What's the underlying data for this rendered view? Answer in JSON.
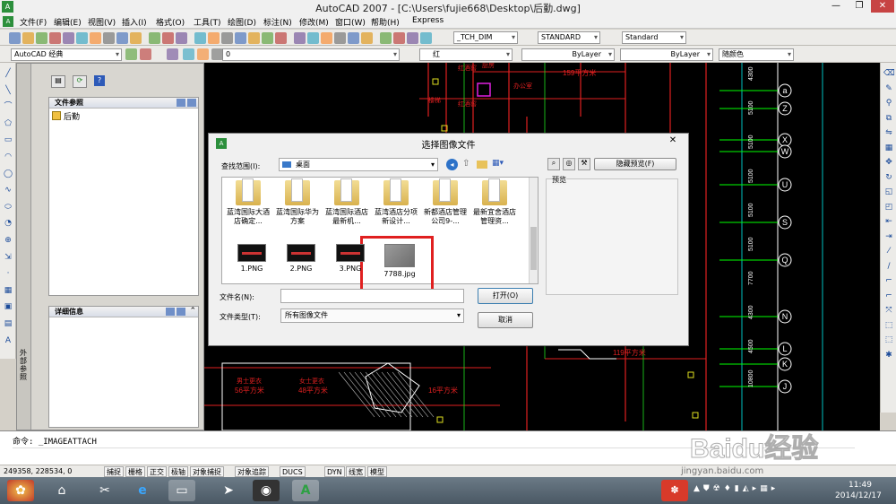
{
  "window": {
    "title": "AutoCAD 2007 - [C:\\Users\\fujie668\\Desktop\\后勤.dwg]"
  },
  "menu": [
    "文件(F)",
    "编辑(E)",
    "视图(V)",
    "插入(I)",
    "格式(O)",
    "工具(T)",
    "绘图(D)",
    "标注(N)",
    "修改(M)",
    "窗口(W)",
    "帮助(H)",
    "Express"
  ],
  "toolbar": {
    "dim_style": "_TCH_DIM",
    "text_style": "STANDARD",
    "table_style": "Standard",
    "workspace": "AutoCAD 经典",
    "layer": "0",
    "color": "红",
    "linetype": "ByLayer",
    "lineweight": "ByLayer",
    "plotstyle": "随颜色"
  },
  "palette": {
    "file_refs_title": "文件参照",
    "tree_item": "后勤",
    "details_title": "详细信息",
    "side_label": "外部参照"
  },
  "dialog": {
    "title": "选择图像文件",
    "lookin_label": "查找范围(I):",
    "lookin_value": "桌面",
    "hide_preview": "隐藏预览(F)",
    "preview_label": "预览",
    "files": [
      {
        "name": "蓝湾国际大酒店确定...",
        "kind": "folder"
      },
      {
        "name": "蓝湾国际华为方案",
        "kind": "folder"
      },
      {
        "name": "蓝湾国际酒店最新机...",
        "kind": "folder"
      },
      {
        "name": "蓝湾酒店分项新设计...",
        "kind": "folder"
      },
      {
        "name": "新都酒店管理公司9-...",
        "kind": "folder"
      },
      {
        "name": "最新宜舍酒店管理资...",
        "kind": "folder"
      },
      {
        "name": "1.PNG",
        "kind": "image"
      },
      {
        "name": "2.PNG",
        "kind": "image"
      },
      {
        "name": "3.PNG",
        "kind": "image"
      },
      {
        "name": "7788.jpg",
        "kind": "image",
        "selected": true
      }
    ],
    "filename_label": "文件名(N):",
    "filename_value": "",
    "filetype_label": "文件类型(T):",
    "filetype_value": "所有图像文件",
    "open_button": "打开(O)",
    "cancel_button": "取消",
    "highlight_color": "#e02020"
  },
  "command": {
    "text": "命令:  _IMAGEATTACH"
  },
  "status": {
    "coords": "249358,  228534,  0",
    "buttons": [
      "捕捉",
      "栅格",
      "正交",
      "极轴",
      "对象捕捉",
      "对象追踪",
      "DUCS",
      "DYN",
      "线宽",
      "模型"
    ]
  },
  "taskbar": {
    "time": "11:49",
    "date": "2014/12/17"
  },
  "drawing": {
    "axis_labels": [
      "a",
      "Z",
      "X",
      "W",
      "U",
      "S",
      "Q",
      "N",
      "L",
      "K",
      "J"
    ],
    "dims": [
      "4300",
      "5100",
      "5100",
      "5100",
      "5100",
      "5100",
      "7700",
      "4300",
      "4500",
      "10800"
    ],
    "rooms": [
      "159平方米",
      "119平方米",
      "56平方米",
      "48平方米",
      "16平方米"
    ],
    "room_names": [
      "红酒窖",
      "红酒窖",
      "厨房",
      "男士更衣",
      "女士更衣",
      "楼梯",
      "办公室"
    ]
  },
  "watermark": {
    "brand": "Baidu经验",
    "url": "jingyan.baidu.com"
  }
}
